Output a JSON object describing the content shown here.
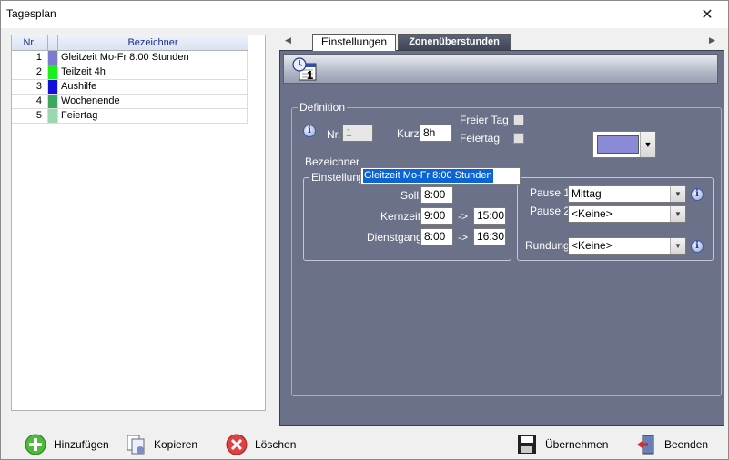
{
  "window": {
    "title": "Tagesplan",
    "close_glyph": "✕"
  },
  "list": {
    "columns": {
      "nr": "Nr.",
      "name": "Bezeichner"
    },
    "rows": [
      {
        "nr": "1",
        "name": "Gleitzeit Mo-Fr 8:00 Stunden",
        "color": "#7b7bd0"
      },
      {
        "nr": "2",
        "name": "Teilzeit 4h",
        "color": "#1aef1a"
      },
      {
        "nr": "3",
        "name": "Aushilfe",
        "color": "#1010d8"
      },
      {
        "nr": "4",
        "name": "Wochenende",
        "color": "#3aa860"
      },
      {
        "nr": "5",
        "name": "Feiertag",
        "color": "#9ad8b4"
      }
    ]
  },
  "tabs": {
    "left_arrow": "◀",
    "right_arrow": "▶",
    "active": "Einstellungen",
    "inactive": "Zonenüberstunden"
  },
  "definition": {
    "group_title": "Definition",
    "nr_label": "Nr.",
    "nr_value": "1",
    "kurz_label": "Kurz",
    "kurz_value": "8h",
    "freier_tag_label": "Freier Tag",
    "feiertag_label": "Feiertag",
    "bezeichner_label": "Bezeichner",
    "bezeichner_value": "Gleitzeit Mo-Fr 8:00 Stunden",
    "color_value": "#8a8ad6",
    "info_glyph": "i"
  },
  "einstellungen": {
    "group_title": "Einstellungen",
    "soll_label": "Soll",
    "soll_value": "8:00",
    "kernzeit_label": "Kernzeit",
    "kernzeit_from": "9:00",
    "kernzeit_to": "15:00",
    "dienstgang_label": "Dienstgang",
    "dienstgang_from": "8:00",
    "dienstgang_to": "16:30",
    "arrow": "->"
  },
  "pausen": {
    "pause1_label": "Pause 1",
    "pause1_value": "Mittag",
    "pause2_label": "Pause 2",
    "pause2_value": "<Keine>",
    "rundung_label": "Rundung",
    "rundung_value": "<Keine>",
    "dropdown_glyph": "▼"
  },
  "toolbar": {
    "add_label": "Hinzufügen",
    "copy_label": "Kopieren",
    "delete_label": "Löschen",
    "apply_label": "Übernehmen",
    "exit_label": "Beenden"
  },
  "icons": {
    "add": "plus-icon",
    "copy": "copy-icon",
    "delete": "delete-icon",
    "apply": "floppy-disk-icon",
    "exit": "exit-door-icon",
    "header": "clock-calendar-icon"
  }
}
